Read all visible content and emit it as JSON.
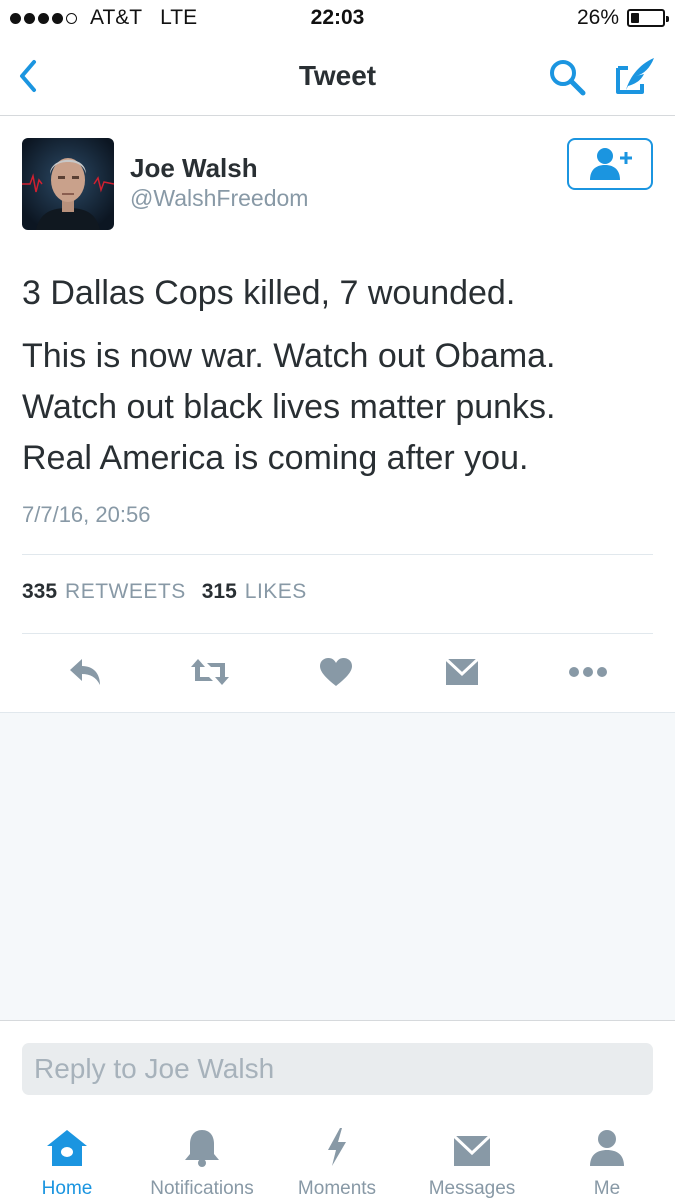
{
  "status_bar": {
    "carrier": "AT&T",
    "network": "LTE",
    "time": "22:03",
    "battery": "26%",
    "battery_level": 0.26,
    "signal_bars": 4
  },
  "nav": {
    "title": "Tweet"
  },
  "tweet": {
    "author_name": "Joe Walsh",
    "author_handle": "@WalshFreedom",
    "line1": "3 Dallas Cops killed, 7 wounded.",
    "line2": "This is now war. Watch out Obama.",
    "line3": "Watch out black lives matter punks.",
    "line4": "Real America is coming after you.",
    "timestamp": "7/7/16, 20:56",
    "retweet_count": "335",
    "retweet_label": "RETWEETS",
    "like_count": "315",
    "like_label": "LIKES"
  },
  "reply": {
    "placeholder": "Reply to Joe Walsh"
  },
  "tabs": [
    {
      "label": "Home",
      "icon": "home-icon"
    },
    {
      "label": "Notifications",
      "icon": "bell-icon"
    },
    {
      "label": "Moments",
      "icon": "lightning-icon"
    },
    {
      "label": "Messages",
      "icon": "envelope-icon"
    },
    {
      "label": "Me",
      "icon": "person-icon"
    }
  ],
  "colors": {
    "accent": "#1b95e0",
    "icon_gray": "#8899a6",
    "text": "#292f33",
    "background_gray": "#f5f8fa"
  }
}
